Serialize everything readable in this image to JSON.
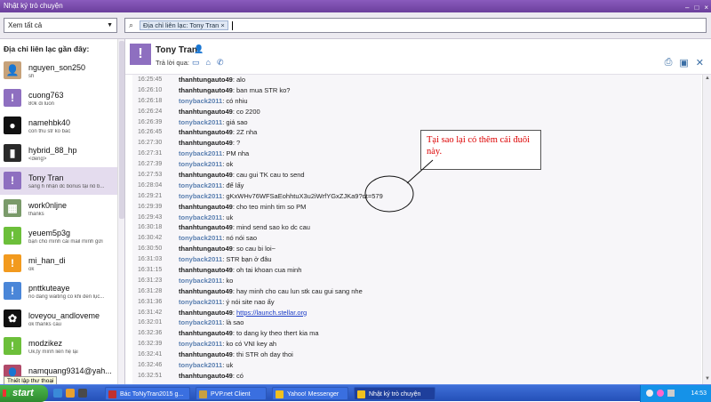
{
  "window": {
    "title": "Nhật ký trò chuyện",
    "controls": [
      "–",
      "□",
      "×"
    ]
  },
  "toolbar": {
    "view_select": "Xem tất cả",
    "search_chip": "Địa chỉ liên lạc: Tony Tran",
    "search_chip_close": "×"
  },
  "sidebar": {
    "heading": "Địa chỉ liên lạc gần đây:",
    "contacts": [
      {
        "name": "nguyen_son250",
        "sub": "sh",
        "avatar_color": "#c7a27a",
        "avatar_char": "👤"
      },
      {
        "name": "cuong763",
        "sub": "80k di luon",
        "avatar_color": "#8e6fc0",
        "avatar_char": "!"
      },
      {
        "name": "namehbk40",
        "sub": "con thu str ko bac",
        "avatar_color": "#111111",
        "avatar_char": "●"
      },
      {
        "name": "hybrid_88_hp",
        "sub": "<deng>",
        "avatar_color": "#2a2a2a",
        "avatar_char": "▮"
      },
      {
        "name": "Tony Tran",
        "sub": "sáng h nhận dc bonus tại nô b...",
        "avatar_color": "#8e6fc0",
        "avatar_char": "!"
      },
      {
        "name": "work0nljne",
        "sub": "thanks",
        "avatar_color": "#7a9a6a",
        "avatar_char": "▦"
      },
      {
        "name": "yeuem5p3g",
        "sub": "bạn cho mình cái mail mình gửi",
        "avatar_color": "#6cbf3a",
        "avatar_char": "!"
      },
      {
        "name": "mi_han_di",
        "sub": "ok",
        "avatar_color": "#f29a1e",
        "avatar_char": "!"
      },
      {
        "name": "pnttkuteaye",
        "sub": "no dang waiting co khi den lục...",
        "avatar_color": "#4a86d8",
        "avatar_char": "!"
      },
      {
        "name": "loveyou_andloveme",
        "sub": "ok thanks cau",
        "avatar_color": "#111111",
        "avatar_char": "✿"
      },
      {
        "name": "modzikez",
        "sub": "Uk,tý mình liên hệ lại",
        "avatar_color": "#6cbf3a",
        "avatar_char": "!"
      },
      {
        "name": "namquang9314@yah...",
        "sub": "",
        "avatar_color": "#b04a6a",
        "avatar_char": "👤"
      }
    ]
  },
  "conversation": {
    "contact_name": "Tony Tran",
    "reply_via": "Trả lời qua:",
    "messages": [
      {
        "time": "16:25:45",
        "user": "thanhtungauto49",
        "text": "alo",
        "me": true
      },
      {
        "time": "16:26:10",
        "user": "thanhtungauto49",
        "text": "ban mua STR ko?",
        "me": true
      },
      {
        "time": "16:26:18",
        "user": "tonyback2011",
        "text": "có nhiu",
        "me": false
      },
      {
        "time": "16:26:24",
        "user": "thanhtungauto49",
        "text": "co 2200",
        "me": true
      },
      {
        "time": "16:26:39",
        "user": "tonyback2011",
        "text": "giá sao",
        "me": false
      },
      {
        "time": "16:26:45",
        "user": "thanhtungauto49",
        "text": "2Z nha",
        "me": true
      },
      {
        "time": "16:27:30",
        "user": "thanhtungauto49",
        "text": "?",
        "me": true
      },
      {
        "time": "16:27:31",
        "user": "tonyback2011",
        "text": "PM nha",
        "me": false
      },
      {
        "time": "16:27:39",
        "user": "tonyback2011",
        "text": "ok",
        "me": false
      },
      {
        "time": "16:27:53",
        "user": "thanhtungauto49",
        "text": "cau gui TK cau to send",
        "me": true
      },
      {
        "time": "16:28:04",
        "user": "tonyback2011",
        "text": "để lấy",
        "me": false
      },
      {
        "time": "16:29:21",
        "user": "tonyback2011",
        "text": "gKxWHv76WFSaEohhtuX3u2iWrfYGxZJKa9?dt=579",
        "me": false
      },
      {
        "time": "16:29:39",
        "user": "thanhtungauto49",
        "text": "cho teo minh tim so PM",
        "me": true
      },
      {
        "time": "16:29:43",
        "user": "tonyback2011",
        "text": "uk",
        "me": false
      },
      {
        "time": "16:30:18",
        "user": "thanhtungauto49",
        "text": "mind send sao ko dc cau",
        "me": true
      },
      {
        "time": "16:30:42",
        "user": "tonyback2011",
        "text": "nó nói sao",
        "me": false
      },
      {
        "time": "16:30:50",
        "user": "thanhtungauto49",
        "text": "so cau bi loi~",
        "me": true
      },
      {
        "time": "16:31:03",
        "user": "tonyback2011",
        "text": "STR bạn ở đâu",
        "me": false
      },
      {
        "time": "16:31:15",
        "user": "thanhtungauto49",
        "text": "oh tai khoan cua minh",
        "me": true
      },
      {
        "time": "16:31:23",
        "user": "tonyback2011",
        "text": "ko",
        "me": false
      },
      {
        "time": "16:31:28",
        "user": "thanhtungauto49",
        "text": "hay minh cho cau lun stk cau gui sang nhe",
        "me": true
      },
      {
        "time": "16:31:36",
        "user": "tonyback2011",
        "text": "ý nói site nao ấy",
        "me": false
      },
      {
        "time": "16:31:42",
        "user": "thanhtungauto49",
        "text": "https://launch.stellar.org",
        "me": true,
        "link": true
      },
      {
        "time": "16:32:01",
        "user": "tonyback2011",
        "text": "là sao",
        "me": false
      },
      {
        "time": "16:32:36",
        "user": "thanhtungauto49",
        "text": "to dang ky theo thert kia ma",
        "me": true
      },
      {
        "time": "16:32:39",
        "user": "tonyback2011",
        "text": "ko có VNI key ah",
        "me": false
      },
      {
        "time": "16:32:41",
        "user": "thanhtungauto49",
        "text": "thi STR oh day thoi",
        "me": true
      },
      {
        "time": "16:32:46",
        "user": "tonyback2011",
        "text": "uk",
        "me": false
      },
      {
        "time": "16:32:51",
        "user": "thanhtungauto49",
        "text": "có",
        "me": true
      }
    ],
    "annotation": "Tại sao lại có thêm cái đuôi này."
  },
  "tooltip": "Thiết lập thư thoại",
  "taskbar": {
    "start": "start",
    "tasks": [
      {
        "label": "Bác ToNyTran2015 g...",
        "color": "#c03030",
        "active": false
      },
      {
        "label": "PVP.net Client",
        "color": "#c8a040",
        "active": false
      },
      {
        "label": "Yahoo! Messenger",
        "color": "#f0c020",
        "active": false
      },
      {
        "label": "Nhật ký trò chuyện",
        "color": "#f0c020",
        "active": true
      }
    ],
    "clock": "14:53"
  }
}
